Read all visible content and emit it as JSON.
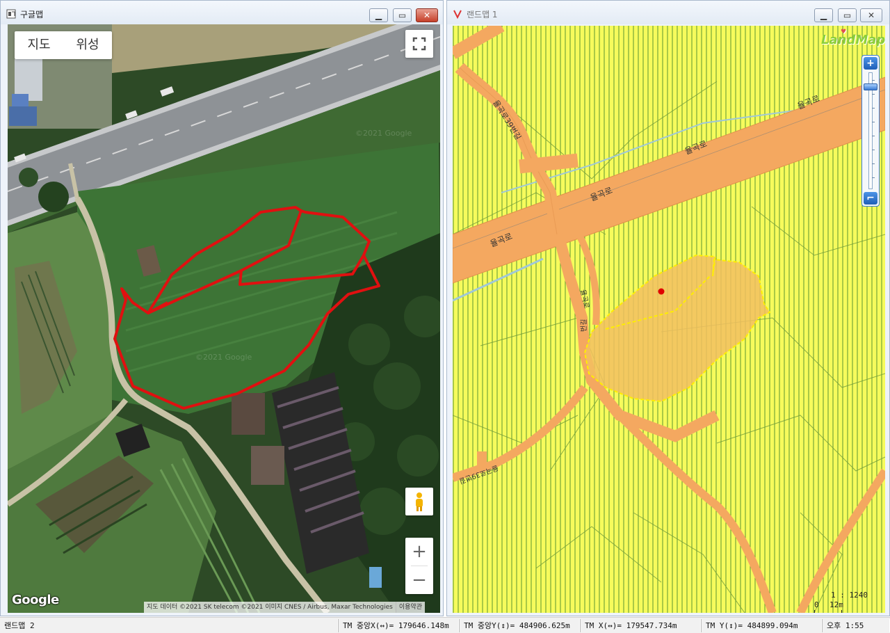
{
  "left_window": {
    "title": "구글맵",
    "map_type": {
      "map_label": "지도",
      "satellite_label": "위성"
    },
    "google_logo": "Google",
    "attribution": "지도 데이터 ©2021 SK telecom ©2021 이미지 CNES / Airbus, Maxar Technologies",
    "terms": "이용약관",
    "watermark": "©2021 Google",
    "zoom_in": "+",
    "zoom_out": "−",
    "parcel_color": "#e01010"
  },
  "right_window": {
    "title": "랜드맵 1",
    "logo": "LandMap",
    "road_labels": {
      "main_road_1": "율곡로",
      "main_road_2": "율곡로",
      "main_road_3": "율곡로",
      "main_road_4": "율곡로",
      "side_road_1": "율곡로39번길",
      "side_road_2": "율곡로",
      "side_road_3": "번길",
      "side_road_4": "율곡로39번길"
    },
    "scale_ratio": "1 : 1240",
    "scale_zero": "0",
    "scale_dist": "12m",
    "zoom_in": "+",
    "zoom_out": "⌐",
    "colors": {
      "background": "#f6fb5c",
      "road": "#f4a860",
      "parcel_fill": "#f2c060",
      "parcel_border": "#ffee00",
      "marker": "#e00000"
    }
  },
  "status_bar": {
    "app": "랜드맵 2",
    "tm_center_x": "TM 중앙X(↔)= 179646.148m",
    "tm_center_y": "TM 중앙Y(↕)= 484906.625m",
    "tm_x": "TM X(↔)= 179547.734m",
    "tm_y": "TM Y(↕)= 484899.094m",
    "time": "오후 1:55"
  }
}
